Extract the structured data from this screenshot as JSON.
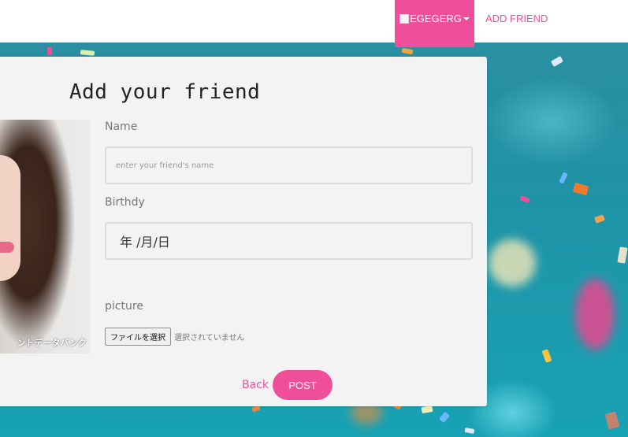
{
  "navbar": {
    "user_label": "EGEGERG",
    "add_friend_label": "ADD FRIEND"
  },
  "form": {
    "title": "Add your friend",
    "name_label": "Name",
    "name_placeholder": "enter your friend's name",
    "birthday_label": "Birthdy",
    "birthday_value": "年 /月/日",
    "picture_label": "picture",
    "file_button_label": "ファイルを選択",
    "file_status": "選択されていません",
    "back_label": "Back",
    "post_label": "POST"
  },
  "photo": {
    "watermark": "ントデータバンク"
  },
  "colors": {
    "accent": "#ef4f99",
    "background": "#1d8a9c",
    "card": "#f3f3f3"
  }
}
